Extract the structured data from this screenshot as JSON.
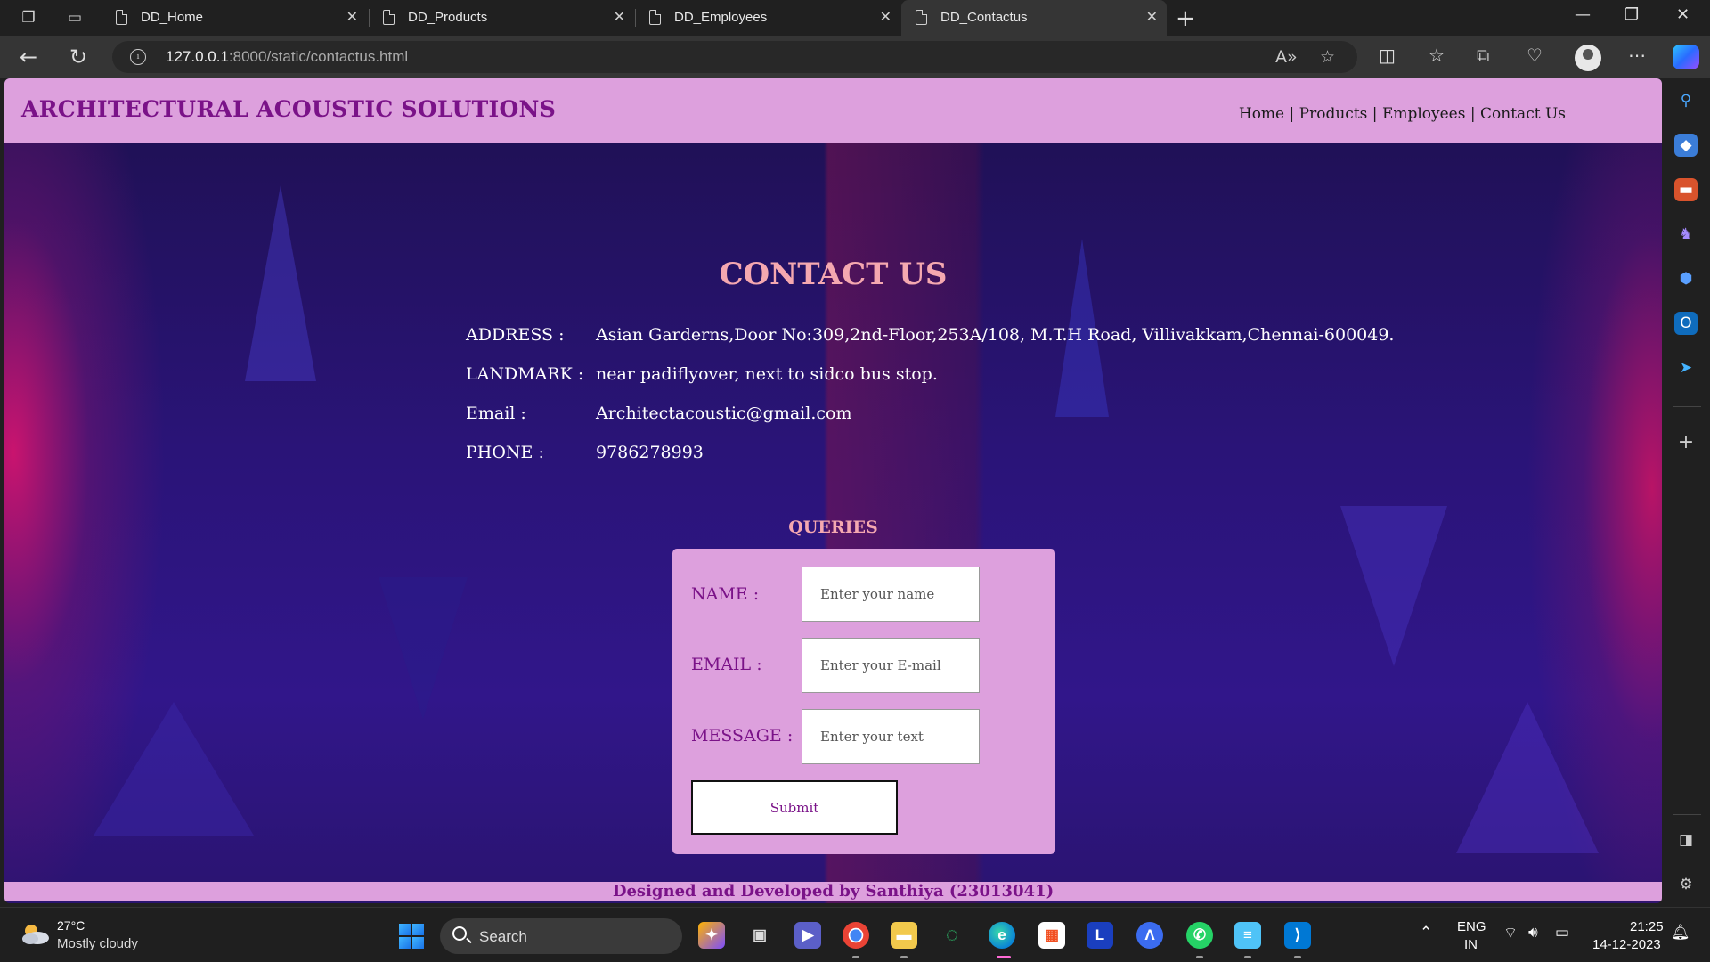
{
  "browser": {
    "tabs": [
      {
        "label": "DD_Home",
        "active": false
      },
      {
        "label": "DD_Products",
        "active": false
      },
      {
        "label": "DD_Employees",
        "active": false
      },
      {
        "label": "DD_Contactus",
        "active": true
      }
    ],
    "url_host": "127.0.0.1",
    "url_rest": ":8000/static/contactus.html"
  },
  "site": {
    "brand": "ARCHITECTURAL ACOUSTIC SOLUTIONS",
    "nav": [
      "Home",
      "Products",
      "Employees",
      "Contact Us"
    ],
    "nav_sep": " | ",
    "title": "CONTACT US",
    "info": [
      {
        "label": "ADDRESS :",
        "value": "Asian Garderns,Door No:309,2nd-Floor,253A/108, M.T.H Road, Villivakkam,Chennai-600049."
      },
      {
        "label": "LANDMARK :",
        "value": "near padiflyover, next to sidco bus stop."
      },
      {
        "label": "Email :",
        "value": "Architectacoustic@gmail.com"
      },
      {
        "label": "PHONE :",
        "value": "9786278993"
      }
    ],
    "queries_title": "QUERIES",
    "form": {
      "name_label": "NAME :",
      "name_placeholder": "Enter your name",
      "email_label": "EMAIL :",
      "email_placeholder": "Enter your E-mail",
      "message_label": "MESSAGE :",
      "message_placeholder": "Enter your text",
      "submit_label": "Submit"
    },
    "footer": "Designed and Developed by Santhiya (23013041)",
    "colors": {
      "accent": "#dda0dd",
      "brand_text": "#7a1288",
      "title_text": "#f5a8b0"
    }
  },
  "taskbar": {
    "weather_temp": "27°C",
    "weather_desc": "Mostly cloudy",
    "search_label": "Search",
    "lang_top": "ENG",
    "lang_bottom": "IN",
    "time": "21:25",
    "date": "14-12-2023"
  }
}
